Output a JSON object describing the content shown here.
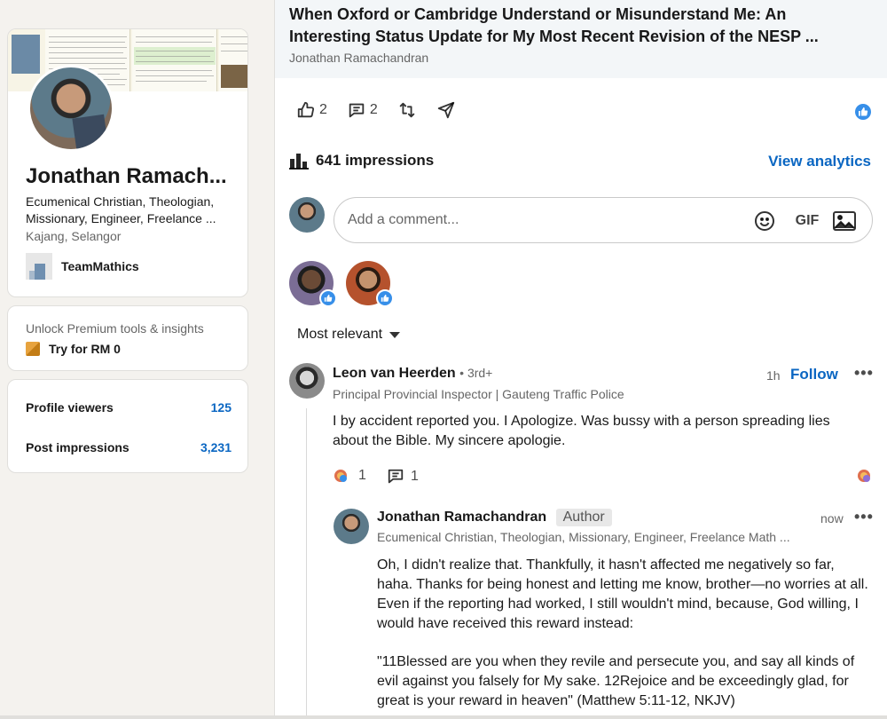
{
  "profile": {
    "name": "Jonathan Ramach...",
    "headline": "Ecumenical Christian, Theologian, Missionary, Engineer, Freelance ...",
    "location": "Kajang, Selangor",
    "company": "TeamMathics"
  },
  "premium": {
    "text": "Unlock Premium tools & insights",
    "cta": "Try for RM 0"
  },
  "stats": {
    "profile_viewers_label": "Profile viewers",
    "profile_viewers_value": "125",
    "post_impressions_label": "Post impressions",
    "post_impressions_value": "3,231"
  },
  "post": {
    "title": "When Oxford or Cambridge Understand or Misunderstand Me: An Interesting Status Update for My Most Recent Revision of the NESP ...",
    "author": "Jonathan Ramachandran",
    "likes": "2",
    "comments": "2",
    "impressions": "641 impressions",
    "view_analytics": "View analytics"
  },
  "comment_box": {
    "placeholder": "Add a comment...",
    "gif_label": "GIF"
  },
  "sort": {
    "label": "Most relevant"
  },
  "comments": [
    {
      "name": "Leon van Heerden",
      "degree": "• 3rd+",
      "headline": "Principal Provincial Inspector | Gauteng Traffic Police",
      "time": "1h",
      "follow": "Follow",
      "body": "I by accident reported you. I Apologize. Was bussy with a person spreading lies about the Bible. My sincere apologie.",
      "reactions": "1",
      "replies": "1"
    },
    {
      "name": "Jonathan Ramachandran",
      "badge": "Author",
      "headline": "Ecumenical Christian, Theologian, Missionary, Engineer, Freelance Math ...",
      "time": "now",
      "body_p1": "Oh, I didn't realize that. Thankfully, it hasn't affected me negatively so far, haha. Thanks for being honest and letting me know, brother—no worries at all. Even if the reporting had worked, I still wouldn't mind, because, God willing, I would have received this reward instead:",
      "body_p2": "\"11Blessed are you when they revile and persecute you, and say all kinds of evil against you falsely for My sake. 12Rejoice and be exceedingly glad, for great is your reward in heaven\" (Matthew 5:11-12, NKJV)"
    }
  ],
  "colors": {
    "accent": "#0a66c2",
    "like_blue": "#378fe9",
    "page_bg": "#f4f2ee"
  }
}
